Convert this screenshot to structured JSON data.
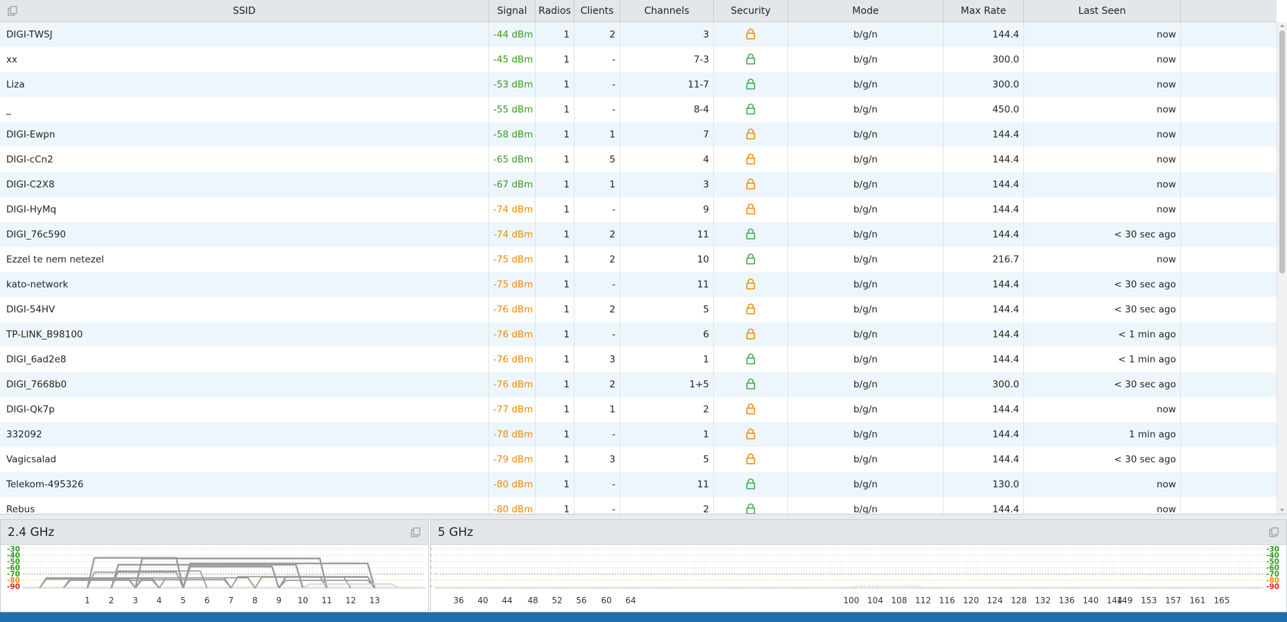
{
  "table": {
    "columns": {
      "ssid": "SSID",
      "signal": "Signal",
      "radios": "Radios",
      "clients": "Clients",
      "channels": "Channels",
      "security": "Security",
      "mode": "Mode",
      "max_rate": "Max Rate",
      "last_seen": "Last Seen"
    },
    "rows": [
      {
        "ssid": "DIGI-TWSJ",
        "signal": "-44 dBm",
        "signal_color": "green",
        "radios": "1",
        "clients": "2",
        "channels": "3",
        "security": "orange-lock-icon",
        "mode": "b/g/n",
        "max_rate": "144.4",
        "last_seen": "now"
      },
      {
        "ssid": "xx",
        "signal": "-45 dBm",
        "signal_color": "green",
        "radios": "1",
        "clients": "-",
        "channels": "7-3",
        "security": "green-lock-icon",
        "mode": "b/g/n",
        "max_rate": "300.0",
        "last_seen": "now"
      },
      {
        "ssid": "Liza",
        "signal": "-53 dBm",
        "signal_color": "green",
        "radios": "1",
        "clients": "-",
        "channels": "11-7",
        "security": "green-lock-icon",
        "mode": "b/g/n",
        "max_rate": "300.0",
        "last_seen": "now"
      },
      {
        "ssid": "_",
        "signal": "-55 dBm",
        "signal_color": "green",
        "radios": "1",
        "clients": "-",
        "channels": "8-4",
        "security": "green-lock-icon",
        "mode": "b/g/n",
        "max_rate": "450.0",
        "last_seen": "now"
      },
      {
        "ssid": "DIGI-Ewpn",
        "signal": "-58 dBm",
        "signal_color": "green",
        "radios": "1",
        "clients": "1",
        "channels": "7",
        "security": "orange-lock-icon",
        "mode": "b/g/n",
        "max_rate": "144.4",
        "last_seen": "now"
      },
      {
        "ssid": "DIGI-cCn2",
        "signal": "-65 dBm",
        "signal_color": "green",
        "radios": "1",
        "clients": "5",
        "channels": "4",
        "security": "orange-lock-icon",
        "mode": "b/g/n",
        "max_rate": "144.4",
        "last_seen": "now"
      },
      {
        "ssid": "DIGI-C2X8",
        "signal": "-67 dBm",
        "signal_color": "green",
        "radios": "1",
        "clients": "1",
        "channels": "3",
        "security": "orange-lock-icon",
        "mode": "b/g/n",
        "max_rate": "144.4",
        "last_seen": "now"
      },
      {
        "ssid": "DIGI-HyMq",
        "signal": "-74 dBm",
        "signal_color": "orange",
        "radios": "1",
        "clients": "-",
        "channels": "9",
        "security": "orange-lock-icon",
        "mode": "b/g/n",
        "max_rate": "144.4",
        "last_seen": "now"
      },
      {
        "ssid": "DIGI_76c590",
        "signal": "-74 dBm",
        "signal_color": "orange",
        "radios": "1",
        "clients": "2",
        "channels": "11",
        "security": "green-lock-icon",
        "mode": "b/g/n",
        "max_rate": "144.4",
        "last_seen": "< 30 sec ago"
      },
      {
        "ssid": "Ezzel te nem netezel",
        "signal": "-75 dBm",
        "signal_color": "orange",
        "radios": "1",
        "clients": "2",
        "channels": "10",
        "security": "green-lock-icon",
        "mode": "b/g/n",
        "max_rate": "216.7",
        "last_seen": "now"
      },
      {
        "ssid": "kato-network",
        "signal": "-75 dBm",
        "signal_color": "orange",
        "radios": "1",
        "clients": "-",
        "channels": "11",
        "security": "orange-lock-icon",
        "mode": "b/g/n",
        "max_rate": "144.4",
        "last_seen": "< 30 sec ago"
      },
      {
        "ssid": "DIGI-54HV",
        "signal": "-76 dBm",
        "signal_color": "orange",
        "radios": "1",
        "clients": "2",
        "channels": "5",
        "security": "orange-lock-icon",
        "mode": "b/g/n",
        "max_rate": "144.4",
        "last_seen": "< 30 sec ago"
      },
      {
        "ssid": "TP-LINK_B98100",
        "signal": "-76 dBm",
        "signal_color": "orange",
        "radios": "1",
        "clients": "-",
        "channels": "6",
        "security": "orange-lock-icon",
        "mode": "b/g/n",
        "max_rate": "144.4",
        "last_seen": "< 1 min ago"
      },
      {
        "ssid": "DIGI_6ad2e8",
        "signal": "-76 dBm",
        "signal_color": "orange",
        "radios": "1",
        "clients": "3",
        "channels": "1",
        "security": "green-lock-icon",
        "mode": "b/g/n",
        "max_rate": "144.4",
        "last_seen": "< 1 min ago"
      },
      {
        "ssid": "DIGI_7668b0",
        "signal": "-76 dBm",
        "signal_color": "orange",
        "radios": "1",
        "clients": "2",
        "channels": "1+5",
        "security": "green-lock-icon",
        "mode": "b/g/n",
        "max_rate": "300.0",
        "last_seen": "< 30 sec ago"
      },
      {
        "ssid": "DIGI-Qk7p",
        "signal": "-77 dBm",
        "signal_color": "orange",
        "radios": "1",
        "clients": "1",
        "channels": "2",
        "security": "orange-lock-icon",
        "mode": "b/g/n",
        "max_rate": "144.4",
        "last_seen": "now"
      },
      {
        "ssid": "332092",
        "signal": "-78 dBm",
        "signal_color": "orange",
        "radios": "1",
        "clients": "-",
        "channels": "1",
        "security": "orange-lock-icon",
        "mode": "b/g/n",
        "max_rate": "144.4",
        "last_seen": "1 min ago"
      },
      {
        "ssid": "Vagicsalad",
        "signal": "-79 dBm",
        "signal_color": "orange",
        "radios": "1",
        "clients": "3",
        "channels": "5",
        "security": "orange-lock-icon",
        "mode": "b/g/n",
        "max_rate": "144.4",
        "last_seen": "< 30 sec ago"
      },
      {
        "ssid": "Telekom-495326",
        "signal": "-80 dBm",
        "signal_color": "orange",
        "radios": "1",
        "clients": "-",
        "channels": "11",
        "security": "green-lock-icon",
        "mode": "b/g/n",
        "max_rate": "130.0",
        "last_seen": "now"
      },
      {
        "ssid": "Rebus",
        "signal": "-80 dBm",
        "signal_color": "orange",
        "radios": "1",
        "clients": "-",
        "channels": "2",
        "security": "green-lock-icon",
        "mode": "b/g/n",
        "max_rate": "144.4",
        "last_seen": "now"
      }
    ]
  },
  "colors": {
    "signal_green": "#3a9a1e",
    "signal_orange": "#f08a00",
    "lock_orange": "#f08a00",
    "lock_green": "#3aa84a",
    "level_green": "#2f9a1a",
    "level_orange": "#f08a00",
    "level_red": "#e02020",
    "curve": "#9a9a9a",
    "status_bar": "#1f6fad"
  },
  "panels": {
    "band24": {
      "title": "2.4 GHz",
      "y_ticks": [
        "-30",
        "-40",
        "-50",
        "-60",
        "-70",
        "-80",
        "-90"
      ],
      "x_ticks": [
        "1",
        "2",
        "3",
        "4",
        "5",
        "6",
        "7",
        "8",
        "9",
        "10",
        "11",
        "12",
        "13"
      ]
    },
    "band5": {
      "title": "5 GHz",
      "y_ticks": [
        "-30",
        "-40",
        "-50",
        "-60",
        "-70",
        "-80",
        "-90"
      ],
      "x_ticks": [
        "36",
        "40",
        "44",
        "48",
        "52",
        "56",
        "60",
        "64",
        "100",
        "104",
        "108",
        "112",
        "116",
        "120",
        "124",
        "128",
        "132",
        "136",
        "140",
        "144",
        "149",
        "153",
        "157",
        "161",
        "165"
      ]
    }
  },
  "chart_data": [
    {
      "type": "area",
      "title": "2.4 GHz",
      "xlabel": "",
      "ylabel": "",
      "ylim": [
        -90,
        -30
      ],
      "x": [
        "1",
        "2",
        "3",
        "4",
        "5",
        "6",
        "7",
        "8",
        "9",
        "10",
        "11",
        "12",
        "13"
      ],
      "series": [
        {
          "channel_from": 1,
          "channel_to": 5,
          "values": [
            -44
          ]
        },
        {
          "channel_from": 3,
          "channel_to": 11,
          "values": [
            -45
          ]
        },
        {
          "channel_from": 5,
          "channel_to": 13,
          "values": [
            -53
          ]
        },
        {
          "channel_from": 2,
          "channel_to": 10,
          "values": [
            -55
          ]
        },
        {
          "channel_from": 5,
          "channel_to": 9,
          "values": [
            -58
          ]
        },
        {
          "channel_from": 2,
          "channel_to": 6,
          "values": [
            -65
          ]
        },
        {
          "channel_from": 1,
          "channel_to": 5,
          "values": [
            -67
          ]
        },
        {
          "channel_from": 7,
          "channel_to": 11,
          "values": [
            -74
          ]
        },
        {
          "channel_from": 9,
          "channel_to": 13,
          "values": [
            -74
          ]
        },
        {
          "channel_from": 8,
          "channel_to": 12,
          "values": [
            -75
          ]
        },
        {
          "channel_from": 9,
          "channel_to": 13,
          "values": [
            -75
          ]
        },
        {
          "channel_from": 3,
          "channel_to": 7,
          "values": [
            -76
          ]
        },
        {
          "channel_from": 4,
          "channel_to": 8,
          "values": [
            -76
          ]
        },
        {
          "channel_from": -1,
          "channel_to": 3,
          "values": [
            -76
          ]
        },
        {
          "channel_from": -1,
          "channel_to": 7,
          "values": [
            -76
          ]
        },
        {
          "channel_from": 0,
          "channel_to": 4,
          "values": [
            -77
          ]
        },
        {
          "channel_from": -1,
          "channel_to": 3,
          "values": [
            -78
          ]
        },
        {
          "channel_from": 3,
          "channel_to": 7,
          "values": [
            -79
          ]
        },
        {
          "channel_from": 9,
          "channel_to": 13,
          "values": [
            -80
          ]
        },
        {
          "channel_from": 0,
          "channel_to": 4,
          "values": [
            -80
          ]
        },
        {
          "channel_from": 10,
          "channel_to": 14,
          "values": [
            -86
          ]
        }
      ]
    },
    {
      "type": "area",
      "title": "5 GHz",
      "xlabel": "",
      "ylabel": "",
      "ylim": [
        -90,
        -30
      ],
      "x": [
        "36",
        "40",
        "44",
        "48",
        "52",
        "56",
        "60",
        "64",
        "100",
        "104",
        "108",
        "112",
        "116",
        "120",
        "124",
        "128",
        "132",
        "136",
        "140",
        "144",
        "149",
        "153",
        "157",
        "161",
        "165"
      ],
      "series": [
        {
          "channel_from": 100,
          "channel_to": 112,
          "values": [
            -89
          ]
        }
      ]
    }
  ]
}
